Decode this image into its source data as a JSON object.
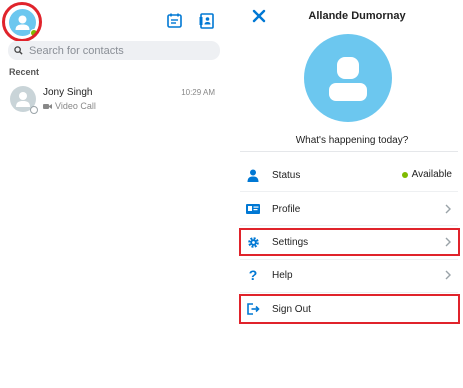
{
  "search": {
    "placeholder": "Search for contacts"
  },
  "recent": {
    "heading": "Recent",
    "items": [
      {
        "name": "Jony Singh",
        "subtitle": "Video Call",
        "time": "10:29 AM"
      }
    ]
  },
  "profile": {
    "name": "Allande Dumornay",
    "mood": "What's happening today?",
    "menu": [
      {
        "label": "Status",
        "value": "Available",
        "icon": "person-icon"
      },
      {
        "label": "Profile",
        "icon": "profile-card-icon"
      },
      {
        "label": "Settings",
        "icon": "gear-icon"
      },
      {
        "label": "Help",
        "icon": "question-icon"
      },
      {
        "label": "Sign Out",
        "icon": "sign-out-icon"
      }
    ]
  },
  "colors": {
    "accent": "#0078d4",
    "avatar_blue": "#6cc7ef",
    "presence_green": "#7fba00",
    "highlight_red": "#e0232b"
  }
}
